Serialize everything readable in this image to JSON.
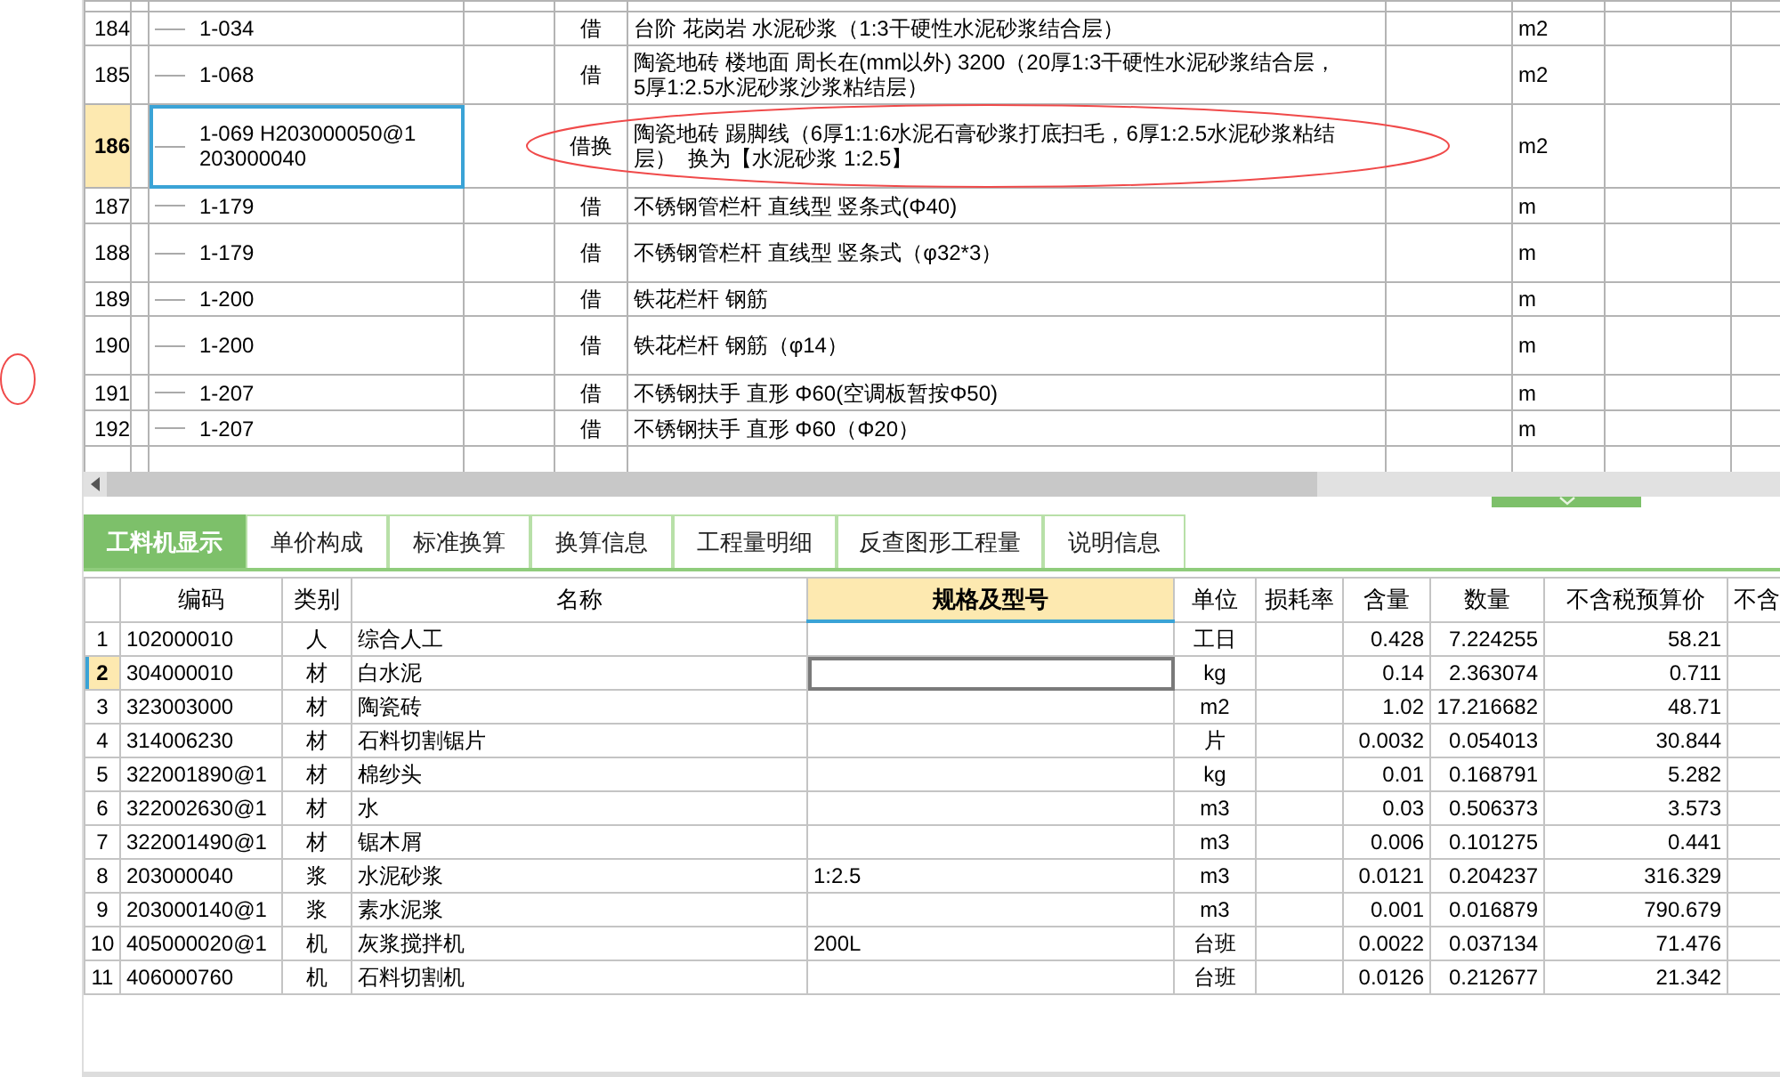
{
  "top_table": {
    "rows": [
      {
        "no": "184",
        "code": "1-034",
        "type": "借",
        "name": "台阶 花岗岩 水泥砂浆（1:3干硬性水泥砂浆结合层）",
        "unit": "m2",
        "selected": false
      },
      {
        "no": "185",
        "code": "1-068",
        "type": "借",
        "name": "陶瓷地砖 楼地面 周长在(mm以外) 3200（20厚1:3干硬性水泥砂浆结合层，5厚1:2.5水泥砂浆沙浆粘结层）",
        "unit": "m2",
        "selected": false
      },
      {
        "no": "186",
        "code": "1-069 H203000050@1 203000040",
        "type": "借换",
        "name": "陶瓷地砖 踢脚线（6厚1:1:6水泥石膏砂浆打底扫毛，6厚1:2.5水泥砂浆粘结层）  换为【水泥砂浆 1:2.5】",
        "unit": "m2",
        "selected": true
      },
      {
        "no": "187",
        "code": "1-179",
        "type": "借",
        "name": "不锈钢管栏杆 直线型 竖条式(Φ40)",
        "unit": "m",
        "selected": false
      },
      {
        "no": "188",
        "code": "1-179",
        "type": "借",
        "name": "不锈钢管栏杆 直线型 竖条式（φ32*3）",
        "unit": "m",
        "selected": false
      },
      {
        "no": "189",
        "code": "1-200",
        "type": "借",
        "name": "铁花栏杆 钢筋",
        "unit": "m",
        "selected": false
      },
      {
        "no": "190",
        "code": "1-200",
        "type": "借",
        "name": "铁花栏杆 钢筋（φ14）",
        "unit": "m",
        "selected": false
      },
      {
        "no": "191",
        "code": "1-207",
        "type": "借",
        "name": "不锈钢扶手 直形 Φ60(空调板暂按Φ50)",
        "unit": "m",
        "selected": false
      },
      {
        "no": "192",
        "code": "1-207",
        "type": "借",
        "name": "不锈钢扶手 直形 Φ60（Φ20）",
        "unit": "m",
        "selected": false
      }
    ]
  },
  "tabs": [
    {
      "label": "工料机显示",
      "selected": true
    },
    {
      "label": "单价构成",
      "selected": false
    },
    {
      "label": "标准换算",
      "selected": false
    },
    {
      "label": "换算信息",
      "selected": false
    },
    {
      "label": "工程量明细",
      "selected": false
    },
    {
      "label": "反查图形工程量",
      "selected": false
    },
    {
      "label": "说明信息",
      "selected": false
    }
  ],
  "detail_table": {
    "columns": [
      {
        "label": "编码",
        "selected": false
      },
      {
        "label": "类别",
        "selected": false
      },
      {
        "label": "名称",
        "selected": false
      },
      {
        "label": "规格及型号",
        "selected": true
      },
      {
        "label": "单位",
        "selected": false
      },
      {
        "label": "损耗率",
        "selected": false
      },
      {
        "label": "含量",
        "selected": false
      },
      {
        "label": "数量",
        "selected": false
      },
      {
        "label": "不含税预算价",
        "selected": false
      },
      {
        "label": "不含",
        "selected": false
      }
    ],
    "rows": [
      {
        "no": "1",
        "code": "102000010",
        "type": "人",
        "name": "综合人工",
        "unit": "工日",
        "content": "0.428",
        "qty": "7.224255",
        "price": "58.21",
        "selected": false
      },
      {
        "no": "2",
        "code": "304000010",
        "type": "材",
        "name": "白水泥",
        "unit": "kg",
        "content": "0.14",
        "qty": "2.363074",
        "price": "0.711",
        "selected": true
      },
      {
        "no": "3",
        "code": "323003000",
        "type": "材",
        "name": "陶瓷砖",
        "unit": "m2",
        "content": "1.02",
        "qty": "17.216682",
        "price": "48.71",
        "selected": false
      },
      {
        "no": "4",
        "code": "314006230",
        "type": "材",
        "name": "石料切割锯片",
        "unit": "片",
        "content": "0.0032",
        "qty": "0.054013",
        "price": "30.844",
        "selected": false
      },
      {
        "no": "5",
        "code": "322001890@1",
        "type": "材",
        "name": "棉纱头",
        "unit": "kg",
        "content": "0.01",
        "qty": "0.168791",
        "price": "5.282",
        "selected": false
      },
      {
        "no": "6",
        "code": "322002630@1",
        "type": "材",
        "name": "水",
        "unit": "m3",
        "content": "0.03",
        "qty": "0.506373",
        "price": "3.573",
        "selected": false
      },
      {
        "no": "7",
        "code": "322001490@1",
        "type": "材",
        "name": "锯木屑",
        "unit": "m3",
        "content": "0.006",
        "qty": "0.101275",
        "price": "0.441",
        "selected": false
      },
      {
        "no": "8",
        "code": "203000040",
        "type": "浆",
        "name": "水泥砂浆",
        "spec": "1:2.5",
        "unit": "m3",
        "content": "0.0121",
        "qty": "0.204237",
        "price": "316.329",
        "selected": false
      },
      {
        "no": "9",
        "code": "203000140@1",
        "type": "浆",
        "name": "素水泥浆",
        "unit": "m3",
        "content": "0.001",
        "qty": "0.016879",
        "price": "790.679",
        "selected": false
      },
      {
        "no": "10",
        "code": "405000020@1",
        "type": "机",
        "name": "灰浆搅拌机",
        "spec": "200L",
        "unit": "台班",
        "content": "0.0022",
        "qty": "0.037134",
        "price": "71.476",
        "selected": false
      },
      {
        "no": "11",
        "code": "406000760",
        "type": "机",
        "name": "石料切割机",
        "unit": "台班",
        "content": "0.0126",
        "qty": "0.212677",
        "price": "21.342",
        "selected": false
      }
    ]
  }
}
